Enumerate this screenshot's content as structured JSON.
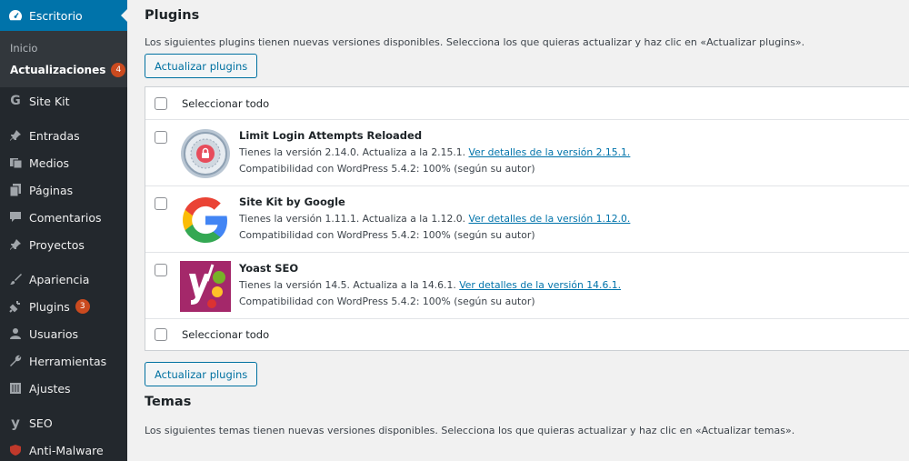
{
  "sidebar": {
    "escritorio": "Escritorio",
    "sub_inicio": "Inicio",
    "sub_actualizaciones": "Actualizaciones",
    "updates_count": "4",
    "sitekit": "Site Kit",
    "entradas": "Entradas",
    "medios": "Medios",
    "paginas": "Páginas",
    "comentarios": "Comentarios",
    "proyectos": "Proyectos",
    "apariencia": "Apariencia",
    "plugins": "Plugins",
    "plugins_count": "3",
    "usuarios": "Usuarios",
    "herramientas": "Herramientas",
    "ajustes": "Ajustes",
    "seo": "SEO",
    "antimalware": "Anti-Malware"
  },
  "plugins_section": {
    "title": "Plugins",
    "description": "Los siguientes plugins tienen nuevas versiones disponibles. Selecciona los que quieras actualizar y haz clic en «Actualizar plugins».",
    "update_button": "Actualizar plugins",
    "select_all": "Seleccionar todo",
    "items": [
      {
        "name": "Limit Login Attempts Reloaded",
        "version_text": "Tienes la versión 2.14.0. Actualiza a la 2.15.1.",
        "details_link": "Ver detalles de la versión 2.15.1.",
        "compat": "Compatibilidad con WordPress 5.4.2: 100% (según su autor)"
      },
      {
        "name": "Site Kit by Google",
        "version_text": "Tienes la versión 1.11.1. Actualiza a la 1.12.0.",
        "details_link": "Ver detalles de la versión 1.12.0.",
        "compat": "Compatibilidad con WordPress 5.4.2: 100% (según su autor)"
      },
      {
        "name": "Yoast SEO",
        "version_text": "Tienes la versión 14.5. Actualiza a la 14.6.1.",
        "details_link": "Ver detalles de la versión 14.6.1.",
        "compat": "Compatibilidad con WordPress 5.4.2: 100% (según su autor)"
      }
    ]
  },
  "themes_section": {
    "title": "Temas",
    "description": "Los siguientes temas tienen nuevas versiones disponibles. Selecciona los que quieras actualizar y haz clic en «Actualizar temas»."
  },
  "colors": {
    "sidebar_bg": "#23282d",
    "accent": "#0073aa",
    "badge": "#ca4a1f"
  }
}
